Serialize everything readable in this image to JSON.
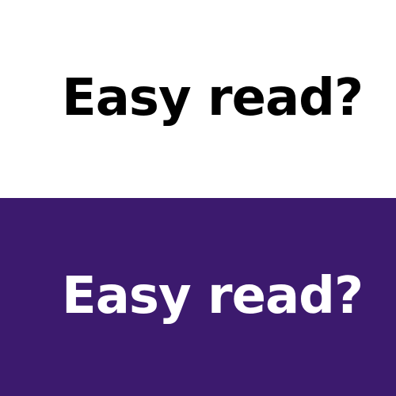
{
  "top_panel": {
    "background": "#ffffff",
    "text_color": "#000000",
    "headline": "Easy read?"
  },
  "bottom_panel": {
    "background": "#3c1a6e",
    "text_color": "#ffffff",
    "headline": "Easy read?"
  }
}
